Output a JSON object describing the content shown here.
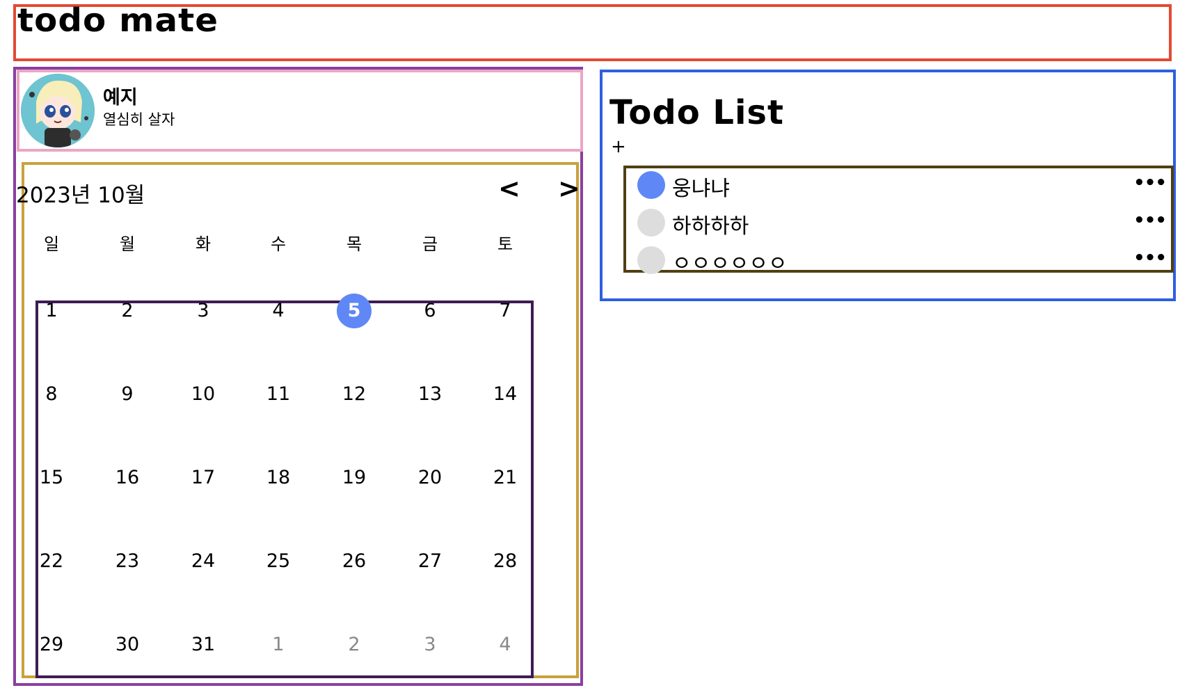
{
  "header": {
    "app_title": "todo mate"
  },
  "profile": {
    "name": "예지",
    "status": "열심히 살자"
  },
  "calendar": {
    "month_label": "2023년 10월",
    "prev_label": "<",
    "next_label": ">",
    "weekdays": [
      "일",
      "월",
      "화",
      "수",
      "목",
      "금",
      "토"
    ],
    "weeks": [
      [
        "1",
        "2",
        "3",
        "4",
        "5",
        "6",
        "7"
      ],
      [
        "8",
        "9",
        "10",
        "11",
        "12",
        "13",
        "14"
      ],
      [
        "15",
        "16",
        "17",
        "18",
        "19",
        "20",
        "21"
      ],
      [
        "22",
        "23",
        "24",
        "25",
        "26",
        "27",
        "28"
      ],
      [
        "29",
        "30",
        "31",
        "1",
        "2",
        "3",
        "4"
      ]
    ],
    "selected_day": "5"
  },
  "todo": {
    "title": "Todo List",
    "add_label": "+",
    "more_label": "•••",
    "items": [
      {
        "text": "웅냐냐",
        "done": true
      },
      {
        "text": "하하하하",
        "done": false
      },
      {
        "text": "ㅇㅇㅇㅇㅇㅇ",
        "done": false
      }
    ]
  },
  "colors": {
    "accent": "#5f87f5",
    "unchecked": "#dddddd",
    "other_month": "#888888"
  }
}
